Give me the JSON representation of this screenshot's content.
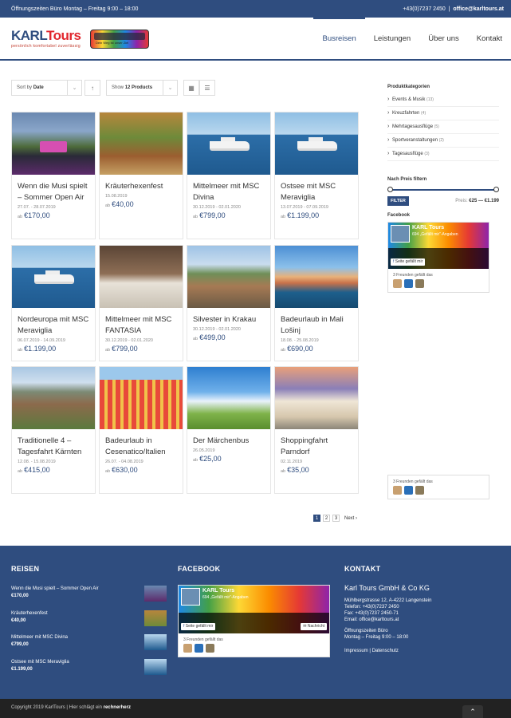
{
  "topbar": {
    "hours": "Öffnungszeiten Büro Montag – Freitag 9:00 – 18:00",
    "phone": "+43(0)7237 2450",
    "email": "office@karltours.at"
  },
  "logo": {
    "name_a": "KARL",
    "name_b": "Tours",
    "tagline": "persönlich  komfortabel  zuverlässig",
    "bus_text": "Dein Weg ist unser Ziel"
  },
  "nav": [
    "Busreisen",
    "Leistungen",
    "Über uns",
    "Kontakt"
  ],
  "toolbar": {
    "sort_prefix": "Sort by",
    "sort_value": "Date",
    "show_prefix": "Show",
    "show_value": "12 Products"
  },
  "products": [
    {
      "title": "Wenn die Musi spielt – Sommer Open Air",
      "date": "27.07. - 28.07.2019",
      "price": "€170,00"
    },
    {
      "title": "Kräuterhexenfest",
      "date": "15.08.2019",
      "price": "€40,00"
    },
    {
      "title": "Mittelmeer mit MSC Divina",
      "date": "30.12.2019 - 02.01.2020",
      "price": "€799,00"
    },
    {
      "title": "Ostsee mit MSC Meraviglia",
      "date": "13.07.2019 - 07.09.2019",
      "price": "€1.199,00"
    },
    {
      "title": "Nordeuropa mit MSC Meraviglia",
      "date": "06.07.2019 - 14.09.2019",
      "price": "€1.199,00"
    },
    {
      "title": "Mittelmeer mit MSC FANTASIA",
      "date": "30.12.2019 - 02.01.2020",
      "price": "€799,00"
    },
    {
      "title": "Silvester in Krakau",
      "date": "30.12.2019 - 02.01.2020",
      "price": "€499,00"
    },
    {
      "title": "Badeurlaub in Mali Lošinj",
      "date": "18.08. - 25.08.2019",
      "price": "€690,00"
    },
    {
      "title": "Traditionelle 4 – Tagesfahrt Kärnten",
      "date": "12.08. - 15.08.2019",
      "price": "€415,00"
    },
    {
      "title": "Badeurlaub in Cesenatico/Italien",
      "date": "26.07. - 04.08.2019",
      "price": "€630,00"
    },
    {
      "title": "Der Märchenbus",
      "date": "26.05.2019",
      "price": "€25,00"
    },
    {
      "title": "Shoppingfahrt Parndorf",
      "date": "02.11.2019",
      "price": "€35,00"
    }
  ],
  "price_prefix": "ab",
  "sidebar": {
    "cat_heading": "Produktkategorien",
    "categories": [
      {
        "name": "Events & Musik",
        "count": "(13)"
      },
      {
        "name": "Kreuzfahrten",
        "count": "(4)"
      },
      {
        "name": "Mehrtagesausflüge",
        "count": "(5)"
      },
      {
        "name": "Sportveranstaltungen",
        "count": "(2)"
      },
      {
        "name": "Tagesausflüge",
        "count": "(3)"
      }
    ],
    "price_heading": "Nach Preis filtern",
    "filter_label": "FILTER",
    "price_label": "Preis:",
    "price_range": "€25 — €1.199",
    "facebook_heading": "Facebook",
    "fb_name": "KARL Tours",
    "fb_likes": "694 „Gefällt mir“-Angaben",
    "fb_like_btn": "Seite gefällt mir",
    "fb_friends": "3 Freunden gefällt das"
  },
  "pagination": {
    "pages": [
      "1",
      "2",
      "3"
    ],
    "next": "Next ›"
  },
  "footer": {
    "reisen_heading": "REISEN",
    "reisen": [
      {
        "title": "Wenn die Musi spielt – Sommer Open Air",
        "price": "€170,00"
      },
      {
        "title": "Kräuterhexenfest",
        "price": "€40,00"
      },
      {
        "title": "Mittelmeer mit MSC Divina",
        "price": "€799,00"
      },
      {
        "title": "Ostsee mit MSC Meraviglia",
        "price": "€1.199,00"
      }
    ],
    "facebook_heading": "FACEBOOK",
    "fb_name": "KARL Tours",
    "fb_likes": "694 „Gefällt mir“-Angaben",
    "fb_like_btn": "Seite gefällt mir",
    "fb_msg_btn": "Nachricht",
    "fb_friends": "3 Freunden gefällt das",
    "kontakt_heading": "KONTAKT",
    "company": "Karl Tours GmbH & Co KG",
    "address": "Mühlbergstrasse 12, A-4222 Langenstein",
    "telefon": "Telefon: +43(0)7237 2450",
    "fax": "Fax: +43(0)7237 2450-71",
    "email": "Email: office@karltours.at",
    "hours_label": "Öffnungszeiten Büro",
    "hours": "Montag – Freitag 9:00 – 18:00",
    "links": "Impressum | Datenschutz"
  },
  "copyright": {
    "text": "Copyright 2019 KarlTours | Hier schlägt ein ",
    "brand": "rechnerherz"
  },
  "colors": {
    "primary": "#2f4d7f",
    "accent": "#e1262d",
    "copyright_bg": "#222222"
  }
}
